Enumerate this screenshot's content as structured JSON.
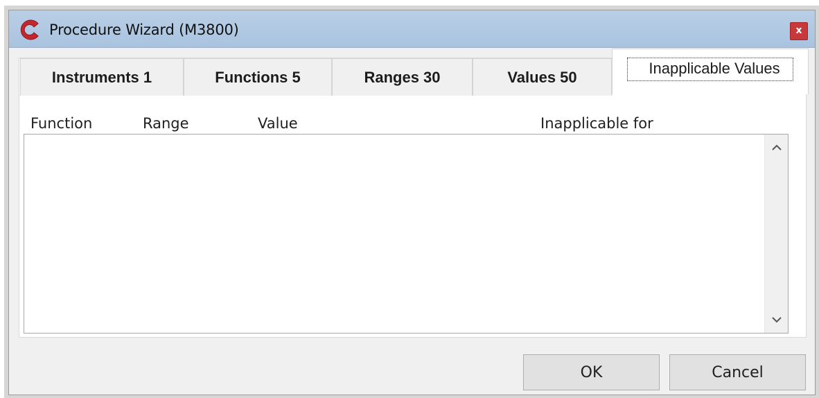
{
  "window": {
    "title": "Procedure Wizard (M3800)",
    "logo_icon": "brand-logo-c",
    "close_label": "x",
    "accent_color": "#c4262e"
  },
  "tabs": [
    {
      "label": "Instruments 1",
      "active": false
    },
    {
      "label": "Functions 5",
      "active": false
    },
    {
      "label": "Ranges 30",
      "active": false
    },
    {
      "label": "Values 50",
      "active": false
    },
    {
      "label": "Inapplicable Values",
      "active": true
    }
  ],
  "columns": [
    "Function",
    "Range",
    "Value",
    "Inapplicable for"
  ],
  "list": {
    "rows": [],
    "scroll_up_icon": "chevron-up-icon",
    "scroll_down_icon": "chevron-down-icon"
  },
  "buttons": {
    "ok_label": "OK",
    "cancel_label": "Cancel"
  }
}
